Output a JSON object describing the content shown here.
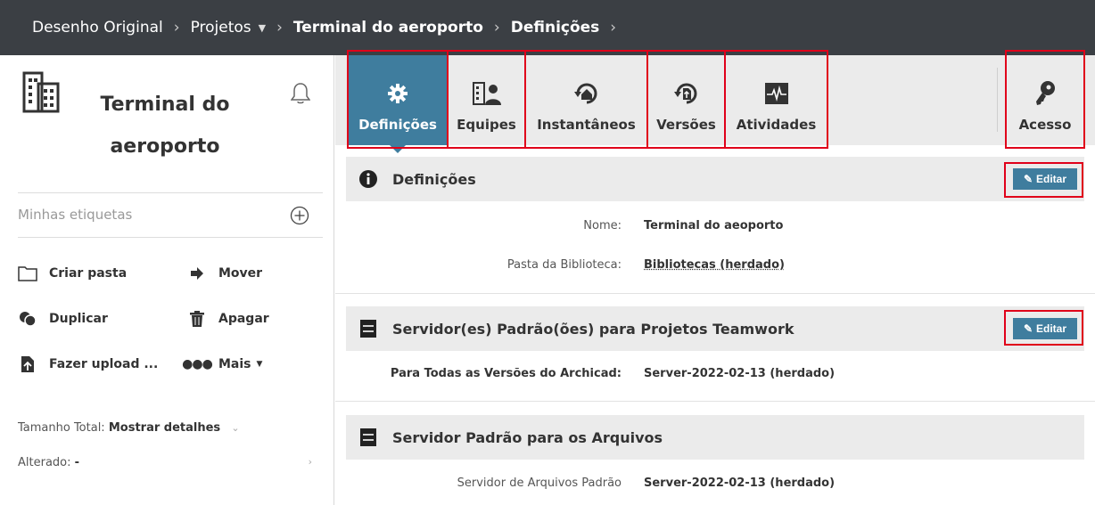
{
  "breadcrumb": {
    "items": [
      "Desenho Original",
      "Projetos",
      "Terminal do aeroporto",
      "Definições"
    ]
  },
  "project": {
    "title_line1": "Terminal do",
    "title_line2": "aeroporto"
  },
  "sidebar": {
    "tags_placeholder": "Minhas etiquetas",
    "actions": {
      "create_folder": "Criar pasta",
      "move": "Mover",
      "duplicate": "Duplicar",
      "delete": "Apagar",
      "upload": "Fazer upload ...",
      "more": "Mais"
    },
    "total_size_label": "Tamanho Total:",
    "total_size_link": "Mostrar detalhes",
    "changed_label": "Alterado:",
    "changed_value": "-"
  },
  "tabs": {
    "settings": "Definições",
    "teams": "Equipes",
    "snapshots": "Instantâneos",
    "versions": "Versões",
    "activities": "Atividades",
    "access": "Acesso"
  },
  "sections": {
    "settings": {
      "title": "Definições",
      "edit": "Editar",
      "name_label": "Nome:",
      "name_value": "Terminal do aeoporto",
      "library_label": "Pasta da Biblioteca:",
      "library_value": "Bibliotecas (herdado)"
    },
    "servers": {
      "title": "Servidor(es) Padrão(ões) para Projetos Teamwork",
      "edit": "Editar",
      "all_versions_label": "Para Todas as Versões do Archicad:",
      "all_versions_value": "Server-2022-02-13 (herdado)"
    },
    "file_server": {
      "title": "Servidor Padrão para os Arquivos",
      "default_label": "Servidor de Arquivos Padrão",
      "default_value": "Server-2022-02-13 (herdado)"
    }
  },
  "colors": {
    "topbar": "#3b3f44",
    "accent": "#3f7d9e",
    "highlight": "#e0001a"
  }
}
